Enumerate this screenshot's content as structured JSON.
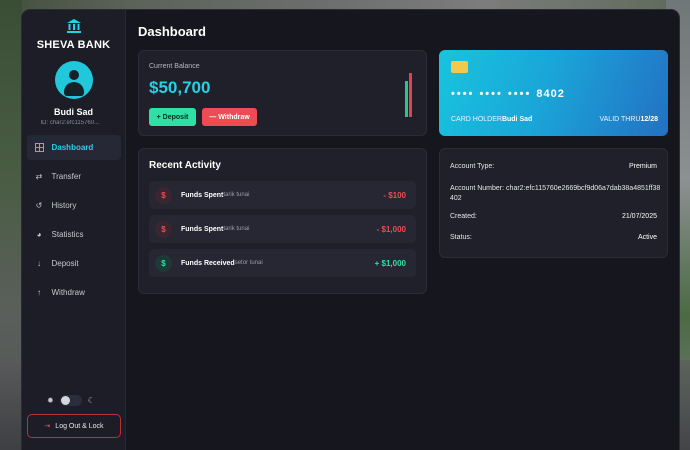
{
  "sidebar": {
    "bank_name": "SHEVA BANK",
    "user_name": "Budi Sad",
    "user_id": "ID: char2:efc115760...",
    "nav": [
      {
        "label": "Dashboard",
        "icon": "grid-icon",
        "active": true
      },
      {
        "label": "Transfer",
        "icon": "transfer-arrows-icon",
        "active": false
      },
      {
        "label": "History",
        "icon": "history-icon",
        "active": false
      },
      {
        "label": "Statistics",
        "icon": "pie-chart-icon",
        "active": false
      },
      {
        "label": "Deposit",
        "icon": "arrow-down-icon",
        "active": false
      },
      {
        "label": "Withdraw",
        "icon": "arrow-up-icon",
        "active": false
      }
    ],
    "logout_label": "Log Out & Lock"
  },
  "main": {
    "title": "Dashboard",
    "balance": {
      "label": "Current Balance",
      "value": "$50,700",
      "deposit_label": "+ Deposit",
      "withdraw_label": "— Withdraw"
    },
    "card": {
      "dots": "•••• •••• ••••",
      "last4": "8402",
      "holder_label": "CARD HOLDER",
      "holder_name": "Budi Sad",
      "valid_label": "VALID THRU",
      "valid_value": "12/28"
    },
    "activity": {
      "title": "Recent Activity",
      "items": [
        {
          "title": "Funds Spent",
          "sub": "tarik tunai",
          "amount": "- $100",
          "kind": "spent"
        },
        {
          "title": "Funds Spent",
          "sub": "tarik tunai",
          "amount": "- $1,000",
          "kind": "spent"
        },
        {
          "title": "Funds Received",
          "sub": "setor tunai",
          "amount": "+ $1,000",
          "kind": "recv"
        }
      ]
    },
    "account_info": {
      "type_label": "Account Type:",
      "type_value": "Premium",
      "number_label": "Account Number:",
      "number_value": "char2:efc115760e2669bcf9d06a7dab38a4851ff38402",
      "created_label": "Created:",
      "created_value": "21/07/2025",
      "status_label": "Status:",
      "status_value": "Active"
    }
  },
  "colors": {
    "accent": "#22d3e6",
    "deposit_green": "#2fe0a4",
    "withdraw_red": "#ee4b55"
  }
}
